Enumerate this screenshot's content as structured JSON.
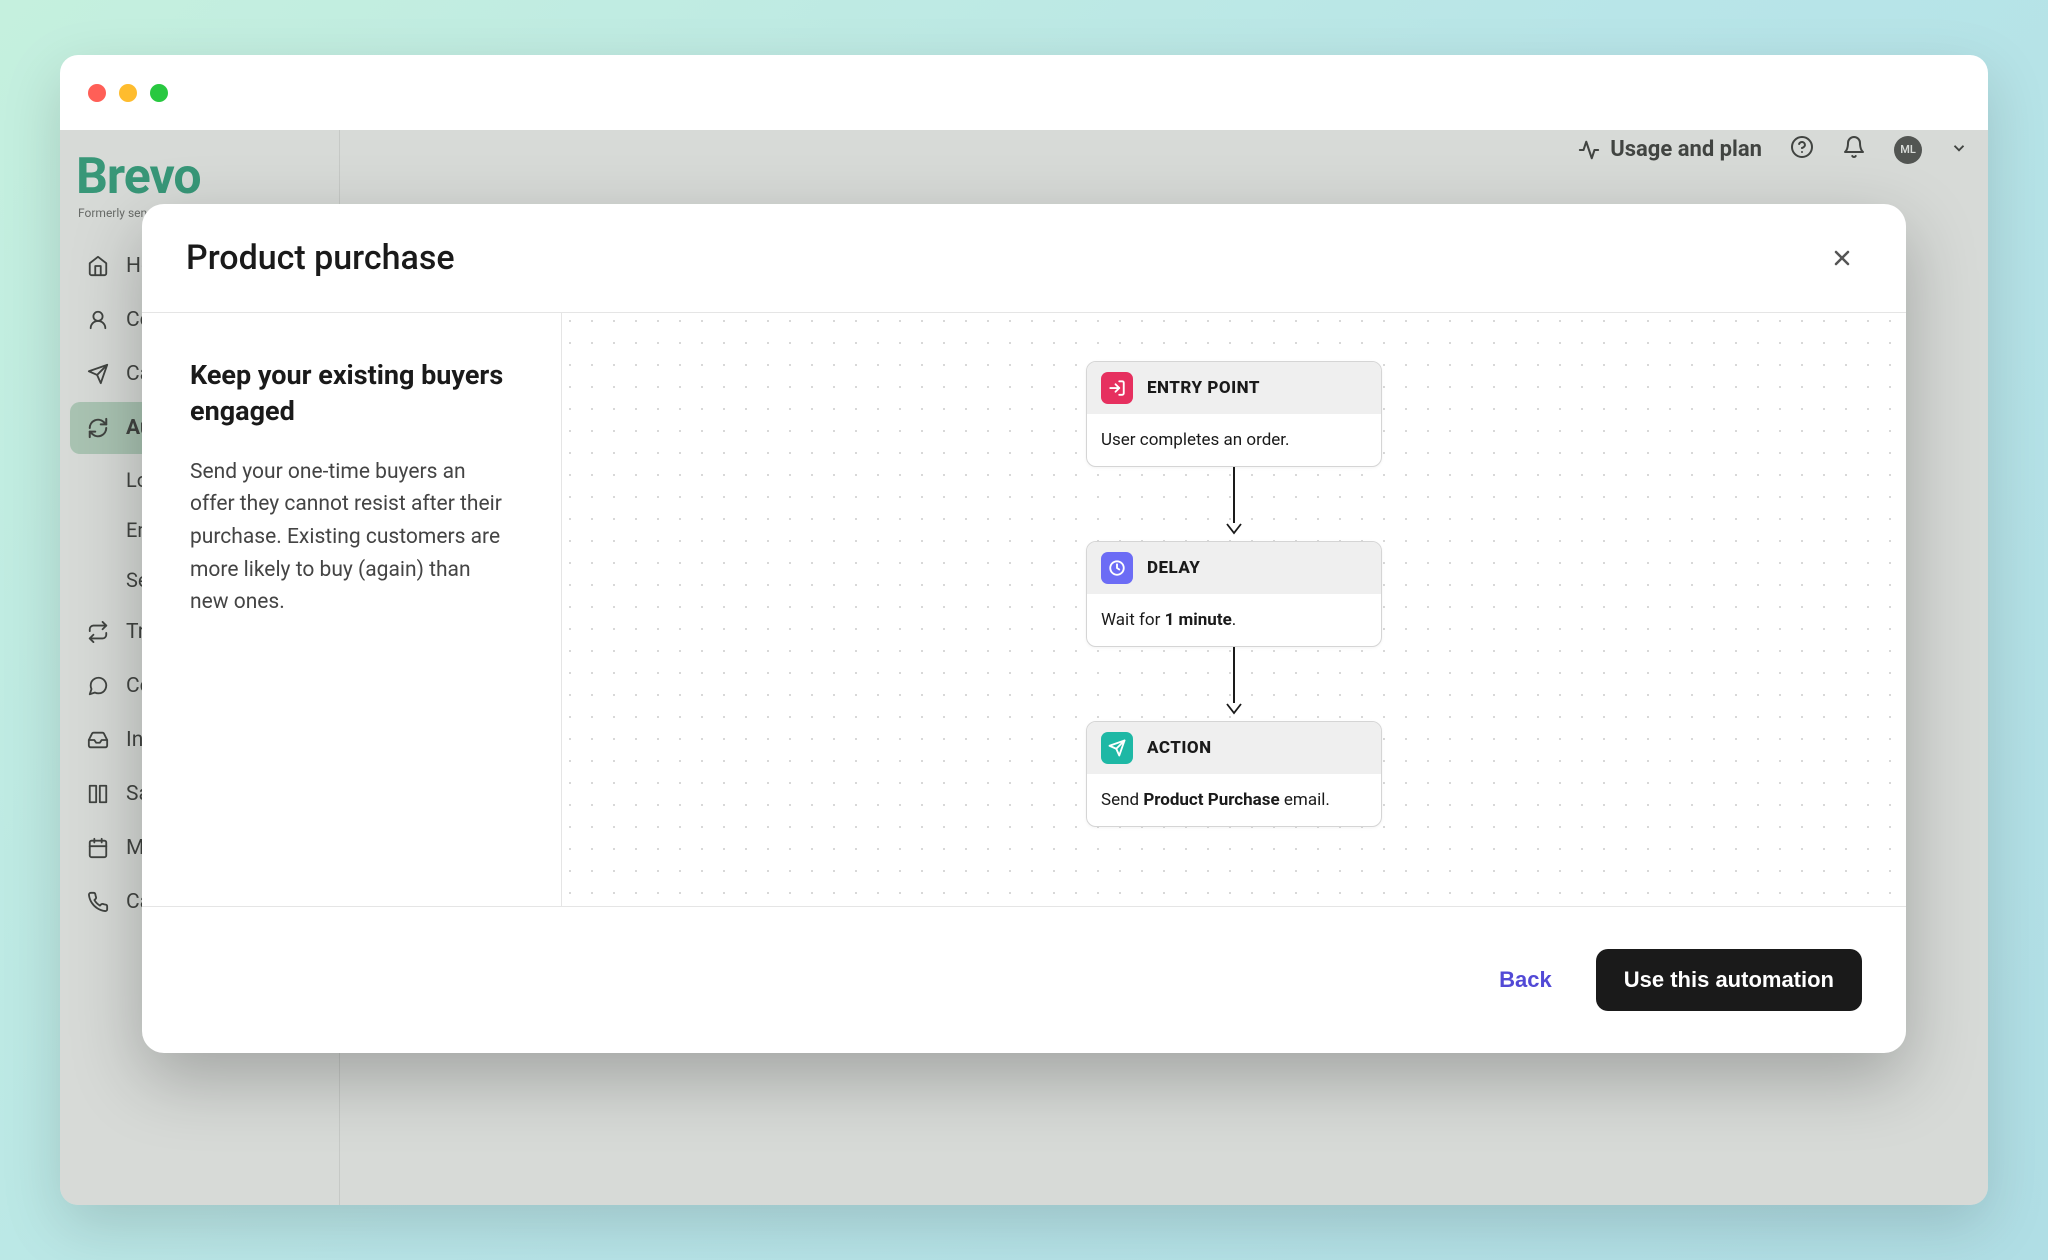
{
  "topbar": {
    "usage": "Usage and plan",
    "avatar": "ML"
  },
  "sidebar": {
    "logo": "Brevo",
    "sublogo": "Formerly send",
    "items": [
      {
        "label": "Home"
      },
      {
        "label": "Contacts"
      },
      {
        "label": "Campaigns"
      },
      {
        "label": "Automations",
        "active": true,
        "sub": [
          "Logs",
          "Email",
          "Settings"
        ]
      },
      {
        "label": "Transactional"
      },
      {
        "label": "Conversations"
      },
      {
        "label": "Inbox"
      },
      {
        "label": "Sales"
      },
      {
        "label": "Meetings"
      },
      {
        "label": "Calls"
      }
    ]
  },
  "modal": {
    "title": "Product purchase",
    "heading": "Keep your existing buyers engaged",
    "desc": "Send your one-time buyers an offer they cannot resist after their purchase. Existing customers are more likely to buy (again) than new ones.",
    "back": "Back",
    "cta": "Use this automation",
    "flow": {
      "entry": {
        "title": "ENTRY POINT",
        "body": "User completes an order."
      },
      "delay": {
        "title": "DELAY",
        "wait_pre": "Wait for ",
        "wait_bold": "1 minute",
        "wait_post": "."
      },
      "action": {
        "title": "ACTION",
        "pre": "Send ",
        "bold": "Product Purchase",
        "post": " email."
      }
    }
  }
}
